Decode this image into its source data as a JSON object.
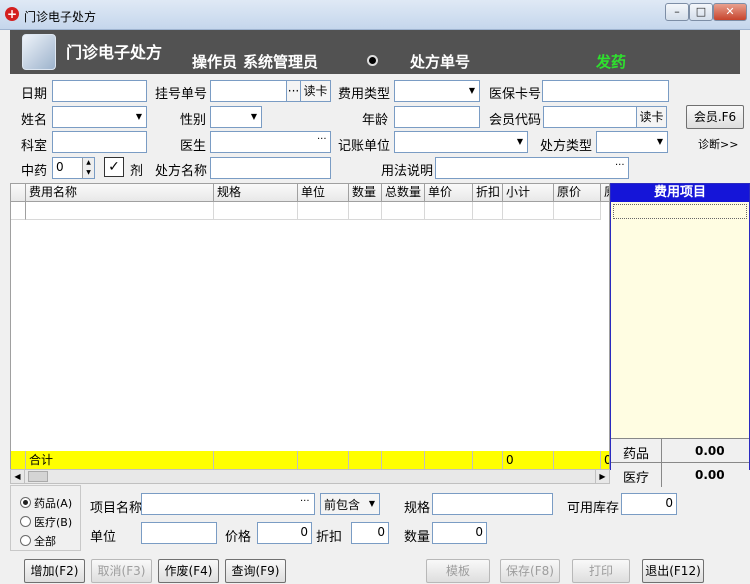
{
  "window": {
    "title": "门诊电子处方",
    "min": "–",
    "max": "□",
    "close": "✕"
  },
  "header": {
    "title": "门诊电子处方",
    "operator_label": "操作员",
    "operator_name": "系统管理员",
    "rx_no_label": "处方单号",
    "status": "发药"
  },
  "form": {
    "date_label": "日期",
    "reg_no_label": "挂号单号",
    "read_card": "读卡",
    "fee_type_label": "费用类型",
    "insurance_card_label": "医保卡号",
    "name_label": "姓名",
    "gender_label": "性别",
    "age_label": "年龄",
    "member_code_label": "会员代码",
    "member_button": "会员.F6",
    "dept_label": "科室",
    "doctor_label": "医生",
    "billing_unit_label": "记账单位",
    "rx_type_label": "处方类型",
    "diagnosis_link": "诊断>>",
    "herbal_label": "中药",
    "herbal_value": "0",
    "dose_label": "剂",
    "rx_name_label": "处方名称",
    "usage_label": "用法说明",
    "ellipsis": "···"
  },
  "grid": {
    "columns": [
      "费用名称",
      "规格",
      "单位",
      "数量",
      "总数量",
      "单价",
      "折扣",
      "小计",
      "原价",
      "原"
    ],
    "total_label": "合计",
    "total_subtotal": "0",
    "total_original": "0"
  },
  "side": {
    "header": "费用项目",
    "rows": [
      {
        "label": "药品",
        "value": "0.00"
      },
      {
        "label": "医疗",
        "value": "0.00"
      }
    ]
  },
  "bottom": {
    "radios": [
      {
        "label": "药品(A)",
        "checked": true
      },
      {
        "label": "医疗(B)",
        "checked": false
      },
      {
        "label": "全部",
        "checked": false
      }
    ],
    "item_name_label": "项目名称",
    "prefix_select": "前包含",
    "spec_label": "规格",
    "stock_label": "可用库存",
    "stock_value": "0",
    "unit_label": "单位",
    "price_label": "价格",
    "price_value": "0",
    "discount_label": "折扣",
    "discount_value": "0",
    "qty_label": "数量",
    "qty_value": "0"
  },
  "buttons": {
    "add": "增加(F2)",
    "cancel": "取消(F3)",
    "void": "作废(F4)",
    "query": "查询(F9)",
    "template": "模板",
    "save": "保存(F8)",
    "print": "打印",
    "exit": "退出(F12)"
  }
}
